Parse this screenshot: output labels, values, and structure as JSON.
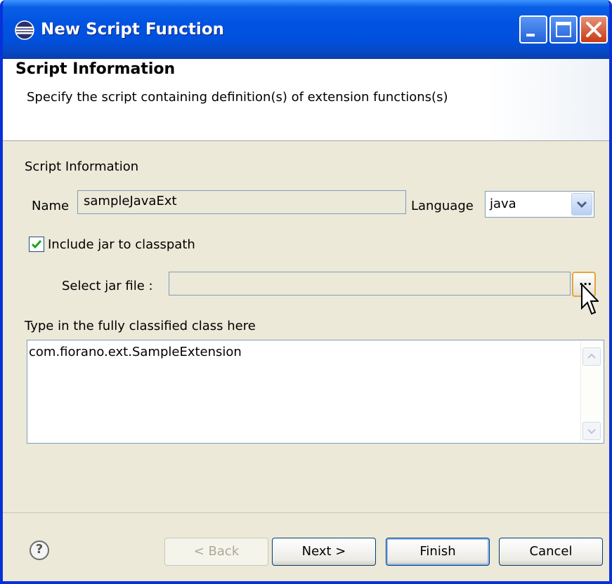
{
  "window": {
    "title": "New Script Function"
  },
  "header": {
    "title": "Script Information",
    "description": "Specify the script containing definition(s) of extension functions(s)"
  },
  "form": {
    "group_label": "Script Information",
    "name_label": "Name",
    "name_value": "sampleJavaExt",
    "language_label": "Language",
    "language_value": "java",
    "include_jar_label": "Include jar to classpath",
    "include_jar_checked": true,
    "select_jar_label": "Select jar file :",
    "select_jar_value": "",
    "browse_label": "...",
    "class_label": "Type in the fully classified class here",
    "class_value": "com.fiorano.ext.SampleExtension"
  },
  "buttons": {
    "help": "?",
    "back": "< Back",
    "next": "Next >",
    "finish": "Finish",
    "cancel": "Cancel"
  },
  "colors": {
    "titlebar": "#0053e1",
    "dialog_bg": "#ece9d8",
    "header_bg": "#ffffff",
    "field_border": "#7f9db9",
    "check_green": "#21a121"
  }
}
